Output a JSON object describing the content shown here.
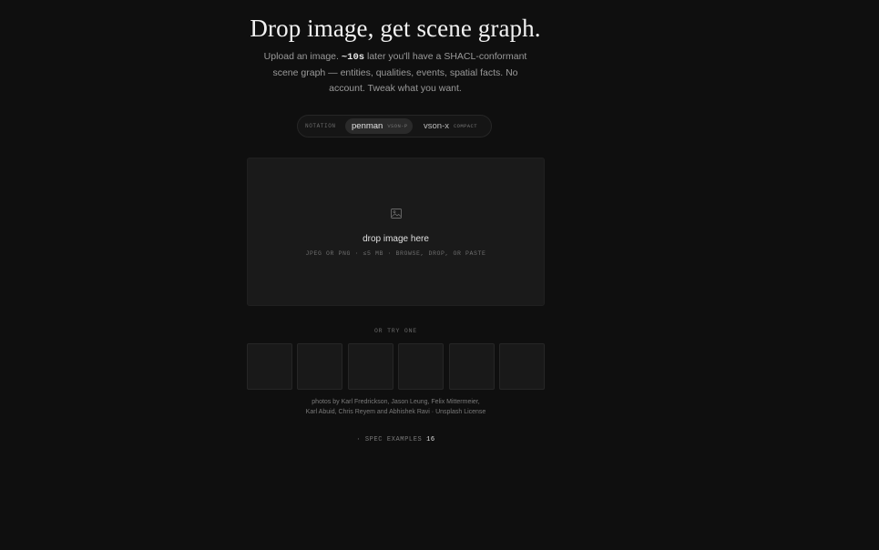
{
  "hero": {
    "title": "Drop image, get scene graph.",
    "sub_before": "Upload an image. ",
    "sub_time": "~10s",
    "sub_after": " later you'll have a SHACL-conformant scene graph — entities, qualities, events, spatial facts. No account. Tweak what you want."
  },
  "notation": {
    "label": "NOTATION",
    "options": [
      {
        "name": "penman",
        "tag": "VSON-P",
        "selected": true
      },
      {
        "name": "vson-x",
        "tag": "COMPACT",
        "selected": false
      }
    ]
  },
  "dropzone": {
    "icon": "image-icon",
    "title": "drop image here",
    "meta": "JPEG OR PNG · ≤5 MB · BROWSE, DROP, OR PASTE"
  },
  "samples": {
    "label": "OR TRY ONE",
    "count": 6
  },
  "credits": {
    "line1": "photos by Karl Fredrickson, Jason Leung, Felix Mittermeier,",
    "line2": "Karl Abuid, Chris Reyem and Abhishek Ravi · Unsplash License"
  },
  "spec": {
    "label": "· SPEC EXAMPLES",
    "count": "16"
  },
  "colors": {
    "background": "#0f0f0f",
    "surface": "#1a1a1a",
    "text": "#e8e8e8",
    "muted": "#7a7a7a"
  }
}
